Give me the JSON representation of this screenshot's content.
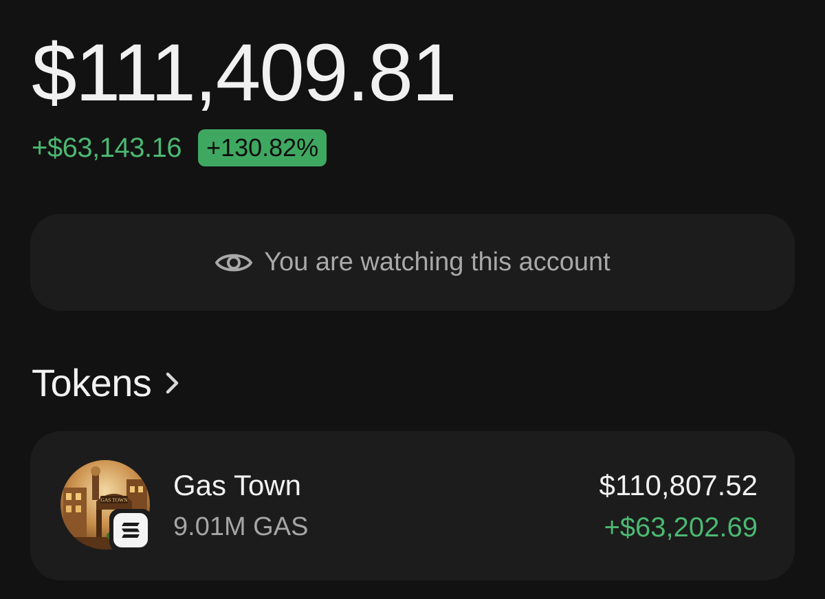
{
  "portfolio": {
    "balance": "$111,409.81",
    "change_amount": "+$63,143.16",
    "change_percent": "+130.82%",
    "positive_color": "#4cb872"
  },
  "watch_banner": {
    "icon": "eye-icon",
    "text": "You are watching this account"
  },
  "tokens_section": {
    "title": "Tokens",
    "icon": "chevron-right-icon"
  },
  "tokens": [
    {
      "name": "Gas Town",
      "amount": "9.01M GAS",
      "value": "$110,807.52",
      "change": "+$63,202.69",
      "avatar_sign": "GAS TOWN",
      "chain_icon": "solana-icon"
    }
  ]
}
